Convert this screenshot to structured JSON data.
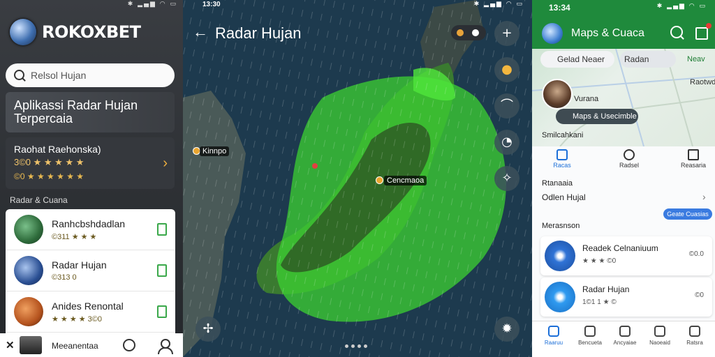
{
  "left": {
    "status": {
      "time": "",
      "icons": "✱ ▂▄▆ ◠ ▭"
    },
    "brand": "ROKOXBET",
    "search_placeholder": "Relsol Hujan",
    "banner": "Aplikassi Radar Hujan Terpercaia",
    "featured": {
      "title": "Raohat Raehonska)",
      "rating_line": "3©0 ★ ★ ★ ★ ★",
      "meta_line": "©0 ★ ★ ★ ★ ★ ★"
    },
    "section_title": "Radar & Cuana",
    "apps": [
      {
        "name": "Ranhcbshdadlan",
        "meta": "©311 ★ ★ ★"
      },
      {
        "name": "Radar Hujan",
        "meta": "©313 0"
      },
      {
        "name": "Anides Renontal",
        "meta": "★ ★ ★ ★ 3©0"
      }
    ],
    "bottom_label": "Meeanentaa"
  },
  "mid": {
    "status": {
      "time": "13:30",
      "icons": "✱ ▂▄▆ ◠ ▭"
    },
    "title": "Radar Hujan",
    "labels": {
      "city1": "Kinnpo",
      "city2": "Cencmaoa"
    }
  },
  "right": {
    "status": {
      "time": "13:34",
      "icons": "✱ ▂▄▆ ◠ ▭"
    },
    "title": "Maps & Cuaca",
    "chip1": "Gelad Neaer",
    "chip2": "Radan",
    "near": "Neav",
    "profile_label": "Vurana",
    "map_chip": "Maps & Usecimble",
    "map_label": "Raotwd",
    "small_label": "Smilcahkani",
    "tabs": [
      {
        "label": "Racas"
      },
      {
        "label": "Radsel"
      },
      {
        "label": "Reasaria"
      }
    ],
    "section1": "Rtanaaia",
    "row1": "Odlen Hujal",
    "blue_chip": "Geate Cuasias",
    "section2": "Merasnson",
    "items": [
      {
        "name": "Readek Celnaniuum",
        "meta": "★ ★ ★ ©0",
        "price": "©0.0"
      },
      {
        "name": "Radar Hujan",
        "meta": "1©1 1 ★ ©",
        "price": "©0"
      }
    ],
    "nav": [
      {
        "label": "Raaruu"
      },
      {
        "label": "Bencueta"
      },
      {
        "label": "Ancyaiae"
      },
      {
        "label": "Naoeaid"
      },
      {
        "label": "Ratsra"
      }
    ]
  }
}
